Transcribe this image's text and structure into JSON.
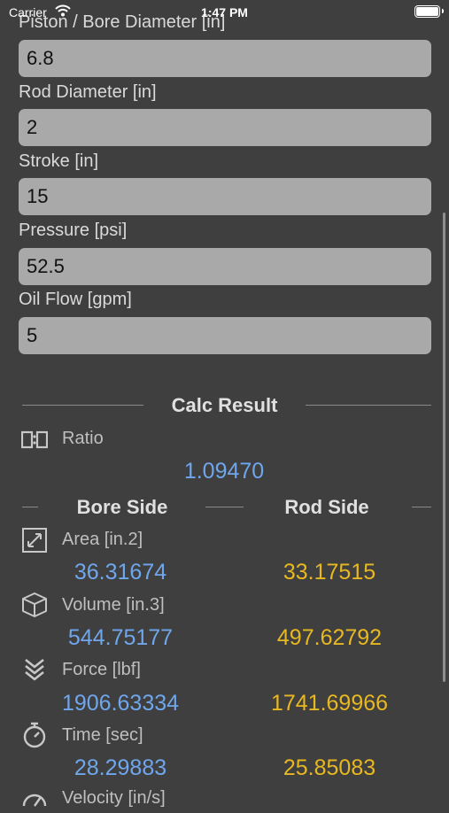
{
  "status_bar": {
    "carrier": "Carrier",
    "time": "1:47 PM"
  },
  "inputs": {
    "bore_label": "Piston / Bore Diameter [in]",
    "bore_value": "6.8",
    "rod_label": "Rod Diameter  [in]",
    "rod_value": "2",
    "stroke_label": "Stroke [in]",
    "stroke_value": "15",
    "pressure_label": "Pressure [psi]",
    "pressure_value": "52.5",
    "flow_label": "Oil Flow [gpm]",
    "flow_value": "5"
  },
  "results": {
    "title": "Calc Result",
    "ratio_label": "Ratio",
    "ratio_value": "1.09470",
    "bore_header": "Bore Side",
    "rod_header": "Rod Side",
    "area_label": "Area [in.2]",
    "area_bore": "36.31674",
    "area_rod": "33.17515",
    "volume_label": "Volume  [in.3]",
    "volume_bore": "544.75177",
    "volume_rod": "497.62792",
    "force_label": "Force [lbf]",
    "force_bore": "1906.63334",
    "force_rod": "1741.69966",
    "time_label": "Time [sec]",
    "time_bore": "28.29883",
    "time_rod": "25.85083",
    "velocity_label": "Velocity [in/s]"
  },
  "colors": {
    "bore_value": "#6fa6ec",
    "rod_value": "#e8b820",
    "field_bg": "#a9a9a9",
    "background": "#3f3f3f"
  },
  "icons": [
    "ratio-icon",
    "area-icon",
    "volume-icon",
    "force-icon",
    "time-icon",
    "velocity-icon"
  ]
}
